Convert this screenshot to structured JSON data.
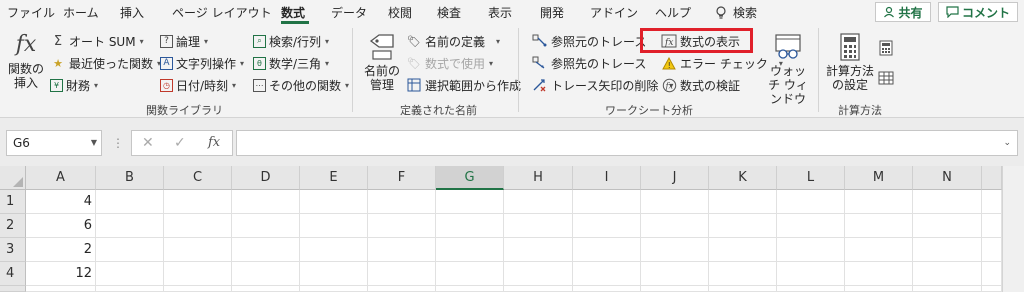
{
  "tabs": [
    "ファイル",
    "ホーム",
    "挿入",
    "ページ レイアウト",
    "数式",
    "データ",
    "校閲",
    "検査",
    "表示",
    "開発",
    "アドイン",
    "ヘルプ"
  ],
  "active_tab": "数式",
  "tell_me": "検索",
  "share_label": "共有",
  "comment_label": "コメント",
  "groups": {
    "function_library": {
      "label": "関数ライブラリ",
      "insert_function": "関数の挿入",
      "autosum": "オート SUM",
      "recent": "最近使った関数",
      "financial": "財務",
      "logical": "論理",
      "text": "文字列操作",
      "datetime": "日付/時刻",
      "lookup": "検索/行列",
      "math": "数学/三角",
      "more": "その他の関数"
    },
    "defined_names": {
      "label": "定義された名前",
      "name_manager": "名前の管理",
      "define_name": "名前の定義",
      "use_in_formula": "数式で使用",
      "create_from_selection": "選択範囲から作成"
    },
    "formula_auditing": {
      "label": "ワークシート分析",
      "trace_precedents": "参照元のトレース",
      "trace_dependents": "参照先のトレース",
      "remove_arrows": "トレース矢印の削除",
      "show_formulas": "数式の表示",
      "error_checking": "エラー チェック",
      "evaluate_formula": "数式の検証",
      "watch_window": "ウォッチ ウィンドウ"
    },
    "calculation": {
      "label": "計算方法",
      "calc_options": "計算方法 の設定"
    }
  },
  "name_box": "G6",
  "formula_value": "",
  "columns": [
    "A",
    "B",
    "C",
    "D",
    "E",
    "F",
    "G",
    "H",
    "I",
    "J",
    "K",
    "L",
    "M",
    "N"
  ],
  "selected_column": "G",
  "rows": [
    "1",
    "2",
    "3",
    "4"
  ],
  "cells_a": [
    "4",
    "6",
    "2",
    "12"
  ],
  "colors": {
    "accent": "#217346",
    "highlight": "#e0202a"
  }
}
